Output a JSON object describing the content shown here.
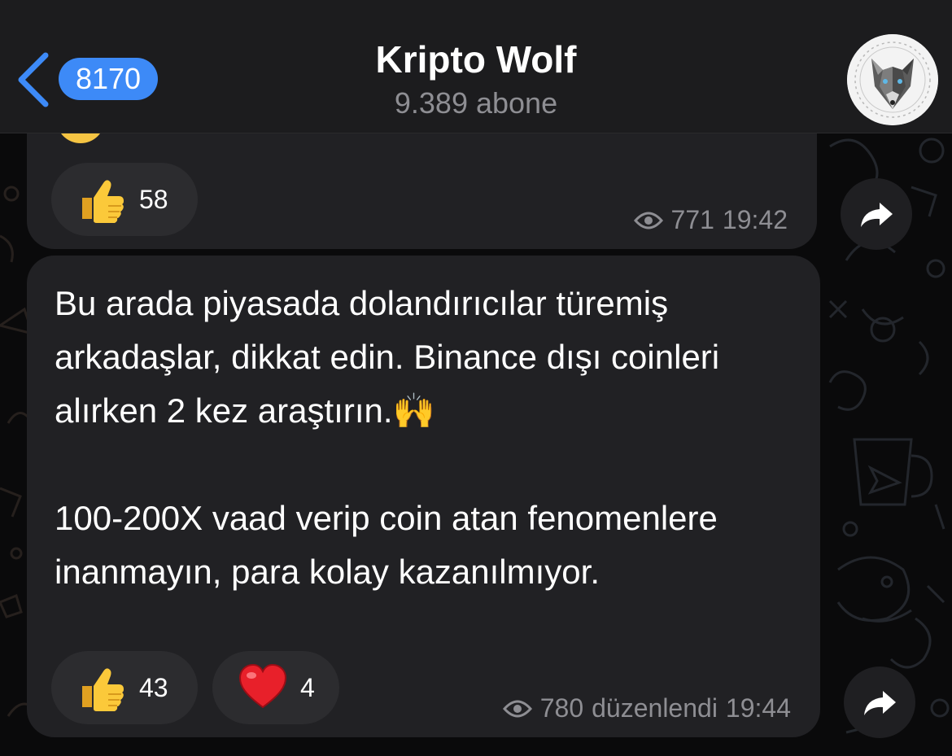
{
  "header": {
    "back_count": "8170",
    "title": "Kripto Wolf",
    "subtitle": "9.389 abone"
  },
  "messages": [
    {
      "text": "",
      "reactions": [
        {
          "emoji": "thumbs-up",
          "count": "58"
        }
      ],
      "views": "771",
      "edited": "",
      "time": "19:42"
    },
    {
      "text": "Bu arada piyasada dolandırıcılar türemiş arkadaşlar, dikkat edin. Binance dışı coinleri alırken 2 kez araştırın.🙌\n\n100-200X vaad verip coin atan fenomenlere inanmayın, para kolay kazanılmıyor.",
      "reactions": [
        {
          "emoji": "thumbs-up",
          "count": "43"
        },
        {
          "emoji": "red-heart",
          "count": "4"
        }
      ],
      "views": "780",
      "edited": "düzenlendi",
      "time": "19:44"
    }
  ],
  "colors": {
    "header_bg": "#1c1c1e",
    "bubble_bg": "#212124",
    "accent": "#3d8af7",
    "muted_text": "#8e8e93"
  }
}
